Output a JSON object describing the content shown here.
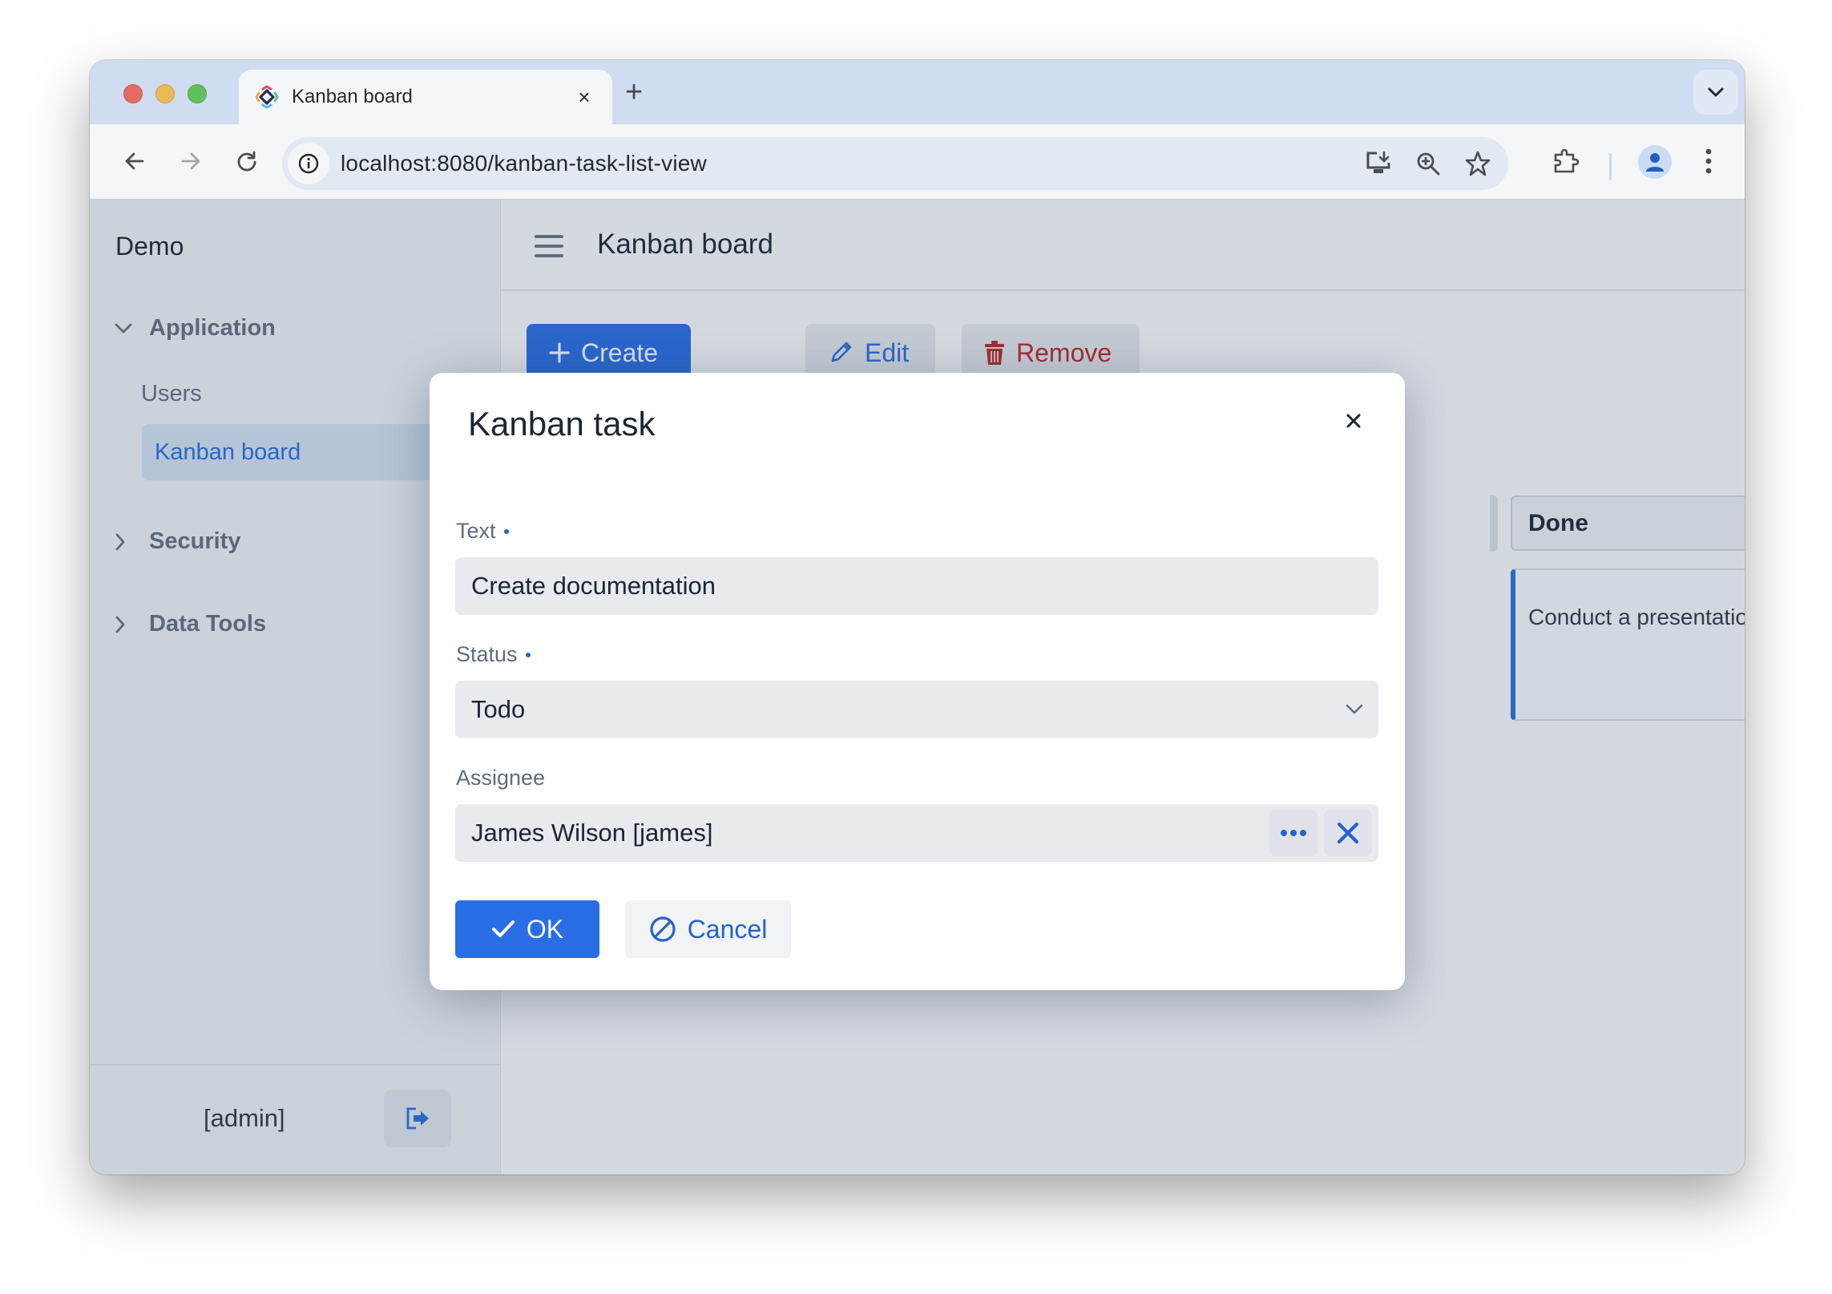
{
  "browser": {
    "tab_title": "Kanban board",
    "tab_close": "×",
    "new_tab": "+",
    "url": "localhost:8080/kanban-task-list-view",
    "icons": {
      "back": "arrow-left-icon",
      "forward": "arrow-right-icon",
      "reload": "reload-icon",
      "site_info": "info-icon",
      "install": "install-app-icon",
      "zoom": "zoom-in-icon",
      "bookmark": "star-icon",
      "extensions": "puzzle-icon",
      "profile": "profile-icon",
      "menu": "more-vertical-icon",
      "tab_list": "chevron-down-icon"
    }
  },
  "sidebar": {
    "brand": "Demo",
    "groups": [
      {
        "label": "Application",
        "expanded": true,
        "items": [
          {
            "label": "Users",
            "active": false
          },
          {
            "label": "Kanban board",
            "active": true
          }
        ]
      },
      {
        "label": "Security",
        "expanded": false,
        "items": []
      },
      {
        "label": "Data Tools",
        "expanded": false,
        "items": []
      }
    ],
    "user": "[admin]",
    "logout_icon": "logout-icon"
  },
  "main": {
    "title": "Kanban board",
    "actions": {
      "create": "Create",
      "edit": "Edit",
      "remove": "Remove"
    },
    "columns": [
      {
        "title": "Done",
        "cards": [
          {
            "text": "Conduct a presentation"
          }
        ]
      }
    ]
  },
  "dialog": {
    "title": "Kanban task",
    "fields": {
      "text": {
        "label": "Text",
        "required": true,
        "value": "Create documentation"
      },
      "status": {
        "label": "Status",
        "required": true,
        "value": "Todo"
      },
      "assignee": {
        "label": "Assignee",
        "required": false,
        "value": "James Wilson [james]"
      }
    },
    "ok": "OK",
    "cancel": "Cancel"
  },
  "colors": {
    "accent": "#2563c8",
    "primary_button": "#2a6ee6",
    "danger": "#a6262a",
    "sidebar_bg": "#d3d8df",
    "tabstrip_bg": "#d7e3f8"
  }
}
